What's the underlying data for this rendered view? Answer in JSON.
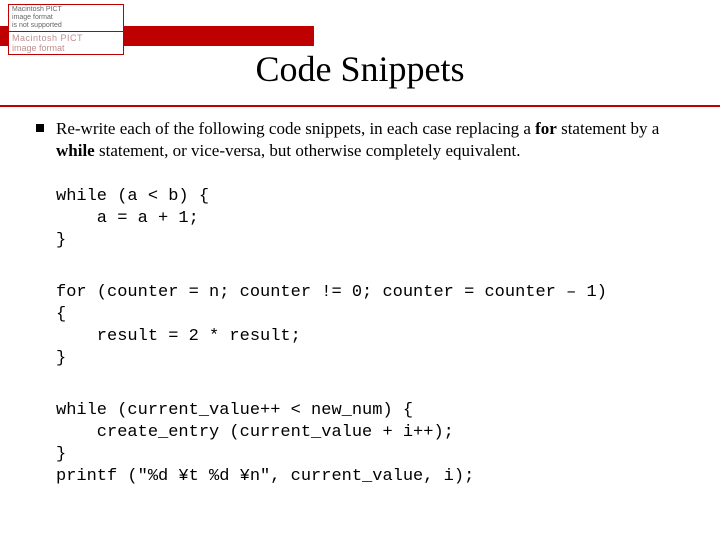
{
  "badge": {
    "top": "Macintosh PICT\nimage format\nis not supported",
    "row1": "Macintosh PICT",
    "row2": "image format"
  },
  "title": "Code Snippets",
  "instruction": {
    "pre1": "Re-write each of the following code snippets, in each case replacing a ",
    "for": "for",
    "mid1": " statement by a ",
    "while": "while",
    "post1": " statement, or vice-versa, but otherwise completely equivalent."
  },
  "snippets": {
    "s1": "while (a < b) {\n    a = a + 1;\n}",
    "s2": "for (counter = n; counter != 0; counter = counter – 1)\n{\n    result = 2 * result;\n}",
    "s3": "while (current_value++ < new_num) {\n    create_entry (current_value + i++);\n}\nprintf (\"%d ¥t %d ¥n\", current_value, i);"
  }
}
